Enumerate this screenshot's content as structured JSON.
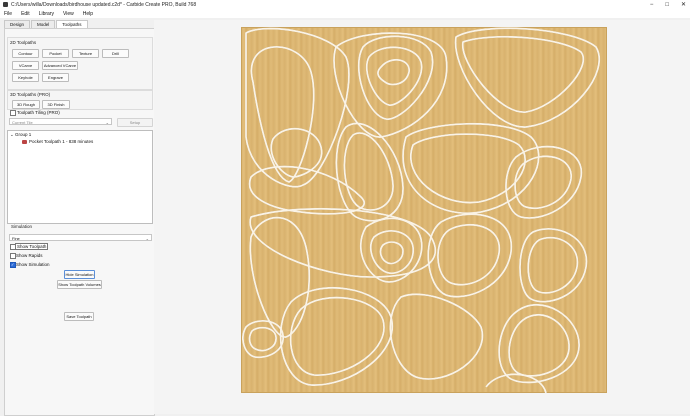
{
  "window": {
    "title": "C:/Users/willa/Downloads/birdhouse updated.c2d* - Carbide Create PRO, Build 768",
    "controls": [
      "−",
      "□",
      "✕"
    ]
  },
  "menu": [
    "File",
    "Edit",
    "Library",
    "View",
    "Help"
  ],
  "tabs": [
    "Design",
    "Model",
    "Toolpaths"
  ],
  "toolpaths_2d": {
    "label": "2D Toolpaths",
    "buttons": [
      "Contour",
      "Pocket",
      "Texture",
      "Drill",
      "VCarve",
      "Advanced VCarve",
      "Keyhole",
      "Engrave"
    ]
  },
  "toolpaths_3d": {
    "label": "3D Toolpaths (PRO)",
    "buttons": [
      "3D Rough",
      "3D Finish"
    ]
  },
  "tiling": {
    "label": "Toolpath Tiling (PRO)",
    "current_tile": "Current Tile",
    "setup": "Setup"
  },
  "tree": {
    "group": "Group 1",
    "item": "Pocket Toolpath 1 - 838 minutes"
  },
  "simulation": {
    "label": "Simulation",
    "quality": "Fine",
    "show_toolpath": "Show Toolpath",
    "show_rapids": "Show Rapids",
    "show_simulation": "Show Simulation",
    "hide_button": "Hide Simulation",
    "volumes_button": "Show Toolpath Volumes",
    "save_button": "Save Toolpath"
  },
  "colors": {
    "wood": "#deb874",
    "groove": "#f7efe0",
    "checkbox_on": "#2a6ad8"
  }
}
